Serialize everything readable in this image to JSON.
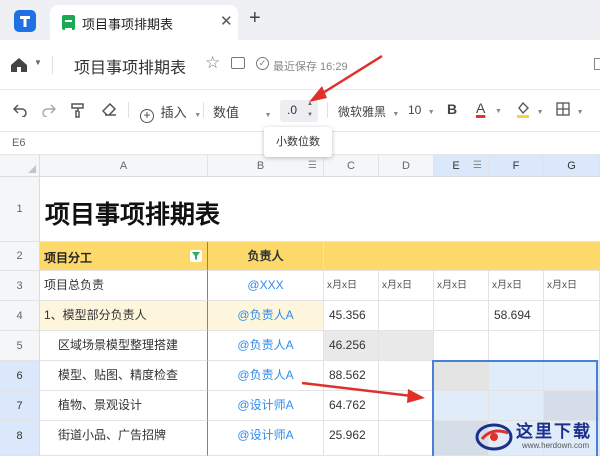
{
  "tabbar": {
    "tab_title": "项目事项排期表",
    "close_glyph": "✕",
    "add_glyph": "+"
  },
  "titlebar": {
    "doc_title": "项目事项排期表",
    "save_status": "最近保存 16:29"
  },
  "toolbar": {
    "insert_label": "插入",
    "format_label": "数值",
    "decimal_value": ".0",
    "font_name": "微软雅黑",
    "font_size": "10",
    "bold_label": "B",
    "font_color_label": "A",
    "accent_red": "#e8312b",
    "fill_yellow": "#f5d33a"
  },
  "tooltip": {
    "text": "小数位数"
  },
  "namebar": {
    "cell_ref": "E6"
  },
  "grid": {
    "columns": [
      "A",
      "B",
      "C",
      "D",
      "E",
      "F",
      "G"
    ],
    "rows": [
      "1",
      "2",
      "3",
      "4",
      "5",
      "6",
      "7",
      "8"
    ],
    "title": "项目事项排期表",
    "header_a": "项目分工",
    "header_b": "负责人",
    "date_label": "x月x日",
    "r3": {
      "a": "项目总负责",
      "b": "@XXX"
    },
    "r4": {
      "a": "1、模型部分负责人",
      "b": "@负责人A",
      "c": "45.356",
      "f": "58.694"
    },
    "r5": {
      "a": "区域场景模型整理搭建",
      "b": "@负责人A",
      "c": "46.256"
    },
    "r6": {
      "a": "模型、贴图、精度检查",
      "b": "@负责人A",
      "c": "88.562"
    },
    "r7": {
      "a": "植物、景观设计",
      "b": "@设计师A",
      "c": "64.762"
    },
    "r8": {
      "a": "街道小品、广告招牌",
      "b": "@设计师A",
      "c": "25.962"
    }
  },
  "colors": {
    "header_yellow": "#fcd96a",
    "mention_blue": "#2d8cf0",
    "selection_blue": "#dbe8fb",
    "arrow_red": "#e0302a"
  },
  "watermark": {
    "text": "这里下载",
    "url": "www.herdown.com"
  }
}
